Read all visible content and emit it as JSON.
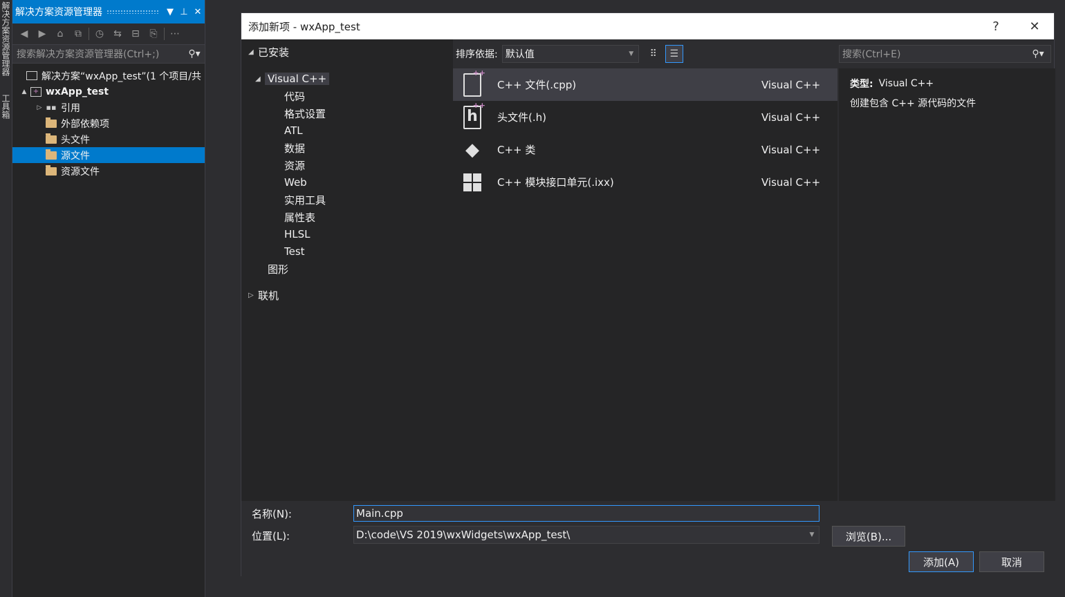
{
  "side_tabs": [
    "解决方案资源管理器",
    "工具箱"
  ],
  "solution_explorer": {
    "title": "解决方案资源管理器",
    "search_placeholder": "搜索解决方案资源管理器(Ctrl+;)",
    "tree": [
      {
        "label": "解决方案“wxApp_test”(1 个项目/共",
        "level": 0,
        "icon": "solution-icon",
        "arrow": ""
      },
      {
        "label": "wxApp_test",
        "level": 0,
        "icon": "cpp-project-icon",
        "arrow": "▲",
        "bold": true
      },
      {
        "label": "引用",
        "level": 1,
        "icon": "references-icon",
        "arrow": "▷"
      },
      {
        "label": "外部依赖项",
        "level": 1,
        "icon": "folder-icon",
        "arrow": ""
      },
      {
        "label": "头文件",
        "level": 1,
        "icon": "folder-icon",
        "arrow": ""
      },
      {
        "label": "源文件",
        "level": 1,
        "icon": "folder-icon",
        "arrow": "",
        "selected": true
      },
      {
        "label": "资源文件",
        "level": 1,
        "icon": "folder-icon",
        "arrow": ""
      }
    ]
  },
  "dialog": {
    "title": "添加新项 - wxApp_test",
    "help": "?",
    "close": "✕",
    "installed_label": "已安装",
    "categories": [
      "Visual C++",
      "代码",
      "格式设置",
      "ATL",
      "数据",
      "资源",
      "Web",
      "实用工具",
      "属性表",
      "HLSL",
      "Test",
      "图形"
    ],
    "online_label": "联机",
    "sort_label": "排序依据:",
    "sort_value": "默认值",
    "search_placeholder": "搜索(Ctrl+E)",
    "items": [
      {
        "name": "C++ 文件(.cpp)",
        "lang": "Visual C++",
        "icon": "cpp-file-icon"
      },
      {
        "name": "头文件(.h)",
        "lang": "Visual C++",
        "icon": "header-file-icon"
      },
      {
        "name": "C++ 类",
        "lang": "Visual C++",
        "icon": "cpp-class-icon"
      },
      {
        "name": "C++ 模块接口单元(.ixx)",
        "lang": "Visual C++",
        "icon": "module-icon"
      }
    ],
    "details": {
      "type_label": "类型:",
      "type_value": "Visual C++",
      "description": "创建包含 C++ 源代码的文件"
    },
    "name_label": "名称(N):",
    "name_value": "Main.cpp",
    "location_label": "位置(L):",
    "location_value": "D:\\code\\VS 2019\\wxWidgets\\wxApp_test\\",
    "browse_label": "浏览(B)...",
    "add_label": "添加(A)",
    "cancel_label": "取消"
  }
}
